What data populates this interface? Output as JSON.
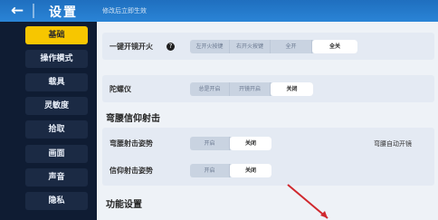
{
  "header": {
    "back_glyph": "←",
    "title": "设置",
    "subtitle": "修改后立即生效"
  },
  "sidebar": {
    "items": [
      {
        "label": "基础",
        "active": true
      },
      {
        "label": "操作模式",
        "active": false
      },
      {
        "label": "载具",
        "active": false
      },
      {
        "label": "灵敏度",
        "active": false
      },
      {
        "label": "拾取",
        "active": false
      },
      {
        "label": "画面",
        "active": false
      },
      {
        "label": "声音",
        "active": false
      },
      {
        "label": "隐私",
        "active": false
      }
    ]
  },
  "settings": {
    "one_key_fire": {
      "label": "一键开镜开火",
      "help_icon": "?",
      "options": [
        "左开火按键",
        "右开火按键",
        "全开",
        "全关"
      ],
      "selected": "全关"
    },
    "gyroscope": {
      "label": "陀螺仪",
      "options": [
        "总是开启",
        "开镜开启",
        "关闭"
      ],
      "selected": "关闭"
    },
    "hip_section_title": "弯腰信仰射击",
    "hip_fire_pose": {
      "label": "弯腰射击姿势",
      "options": [
        "开启",
        "关闭"
      ],
      "selected": "关闭",
      "right_label": "弯腰自动开镜"
    },
    "faith_fire_pose": {
      "label": "信仰射击姿势",
      "options": [
        "开启",
        "关闭"
      ],
      "selected": "关闭"
    },
    "function_section_title": "功能设置"
  },
  "colors": {
    "accent": "#f7c600",
    "sidebar_bg": "#0f1c33",
    "header_bg": "#2a84d6",
    "annotation_arrow": "#d0282e"
  }
}
